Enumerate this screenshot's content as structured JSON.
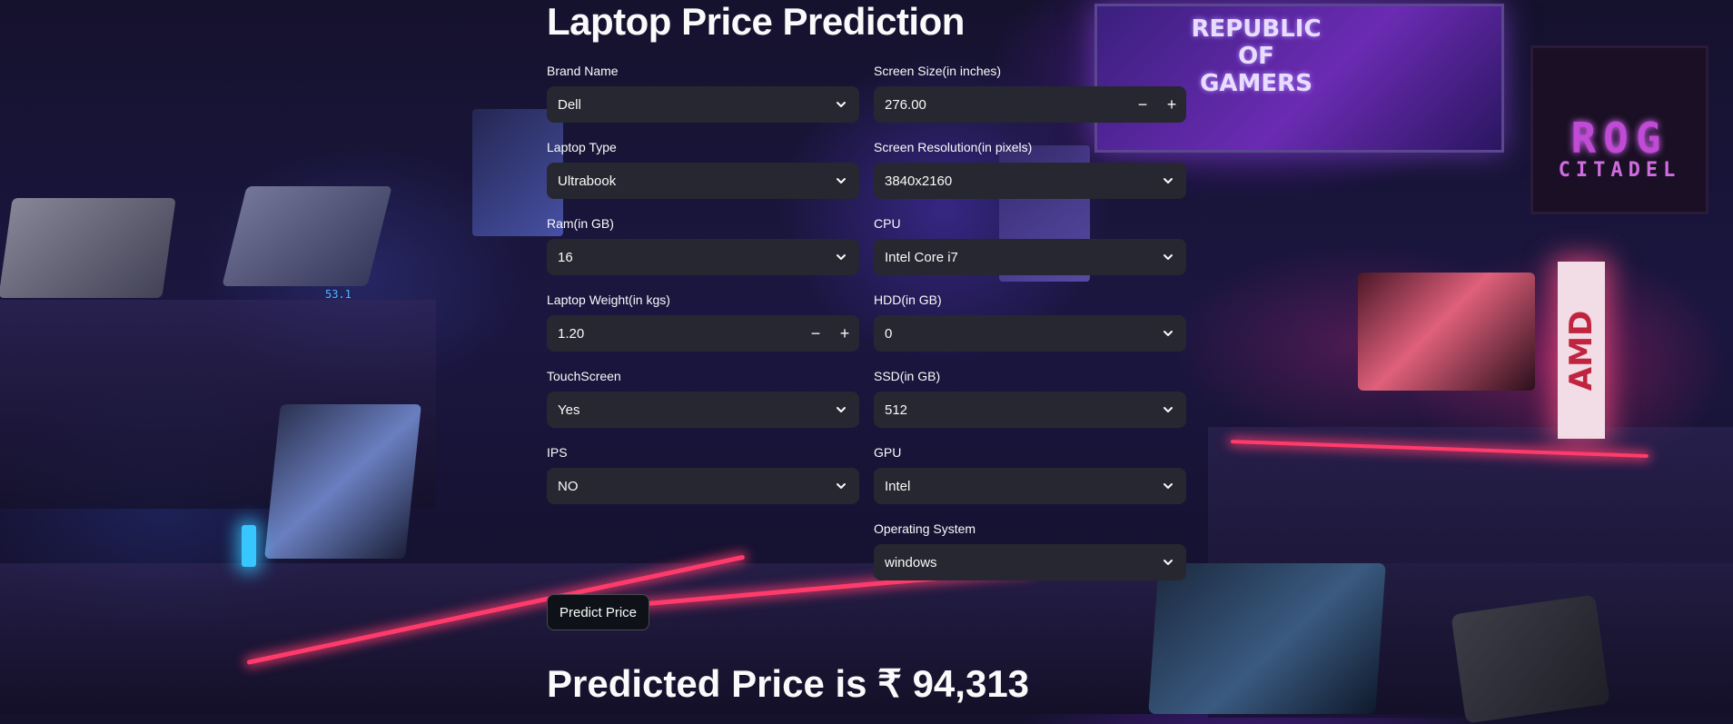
{
  "app": {
    "title": "Laptop Price Prediction"
  },
  "fields": {
    "brand": {
      "label": "Brand Name",
      "value": "Dell"
    },
    "screen_size": {
      "label": "Screen Size(in inches)",
      "value": "276.00",
      "minus": "−",
      "plus": "+"
    },
    "laptop_type": {
      "label": "Laptop Type",
      "value": "Ultrabook"
    },
    "resolution": {
      "label": "Screen Resolution(in pixels)",
      "value": "3840x2160"
    },
    "ram": {
      "label": "Ram(in GB)",
      "value": "16"
    },
    "cpu": {
      "label": "CPU",
      "value": "Intel Core i7"
    },
    "weight": {
      "label": "Laptop Weight(in kgs)",
      "value": "1.20",
      "minus": "−",
      "plus": "+"
    },
    "hdd": {
      "label": "HDD(in GB)",
      "value": "0"
    },
    "touchscreen": {
      "label": "TouchScreen",
      "value": "Yes"
    },
    "ssd": {
      "label": "SSD(in GB)",
      "value": "512"
    },
    "ips": {
      "label": "IPS",
      "value": "NO"
    },
    "gpu": {
      "label": "GPU",
      "value": "Intel"
    },
    "os": {
      "label": "Operating System",
      "value": "windows"
    }
  },
  "actions": {
    "predict_label": "Predict Price"
  },
  "result": {
    "text": "Predicted Price is ₹ 94,313"
  },
  "background": {
    "poster_text": "REPUBLIC OF GAMERS",
    "sign_top": "ROG",
    "sign_bottom": "CITADEL",
    "amd_sign": "AMD",
    "device_display": "53.1"
  },
  "colors": {
    "control_bg": "#262730",
    "button_bg": "#0e1117",
    "text": "#fafafa",
    "neon": "#ff3b6b"
  }
}
